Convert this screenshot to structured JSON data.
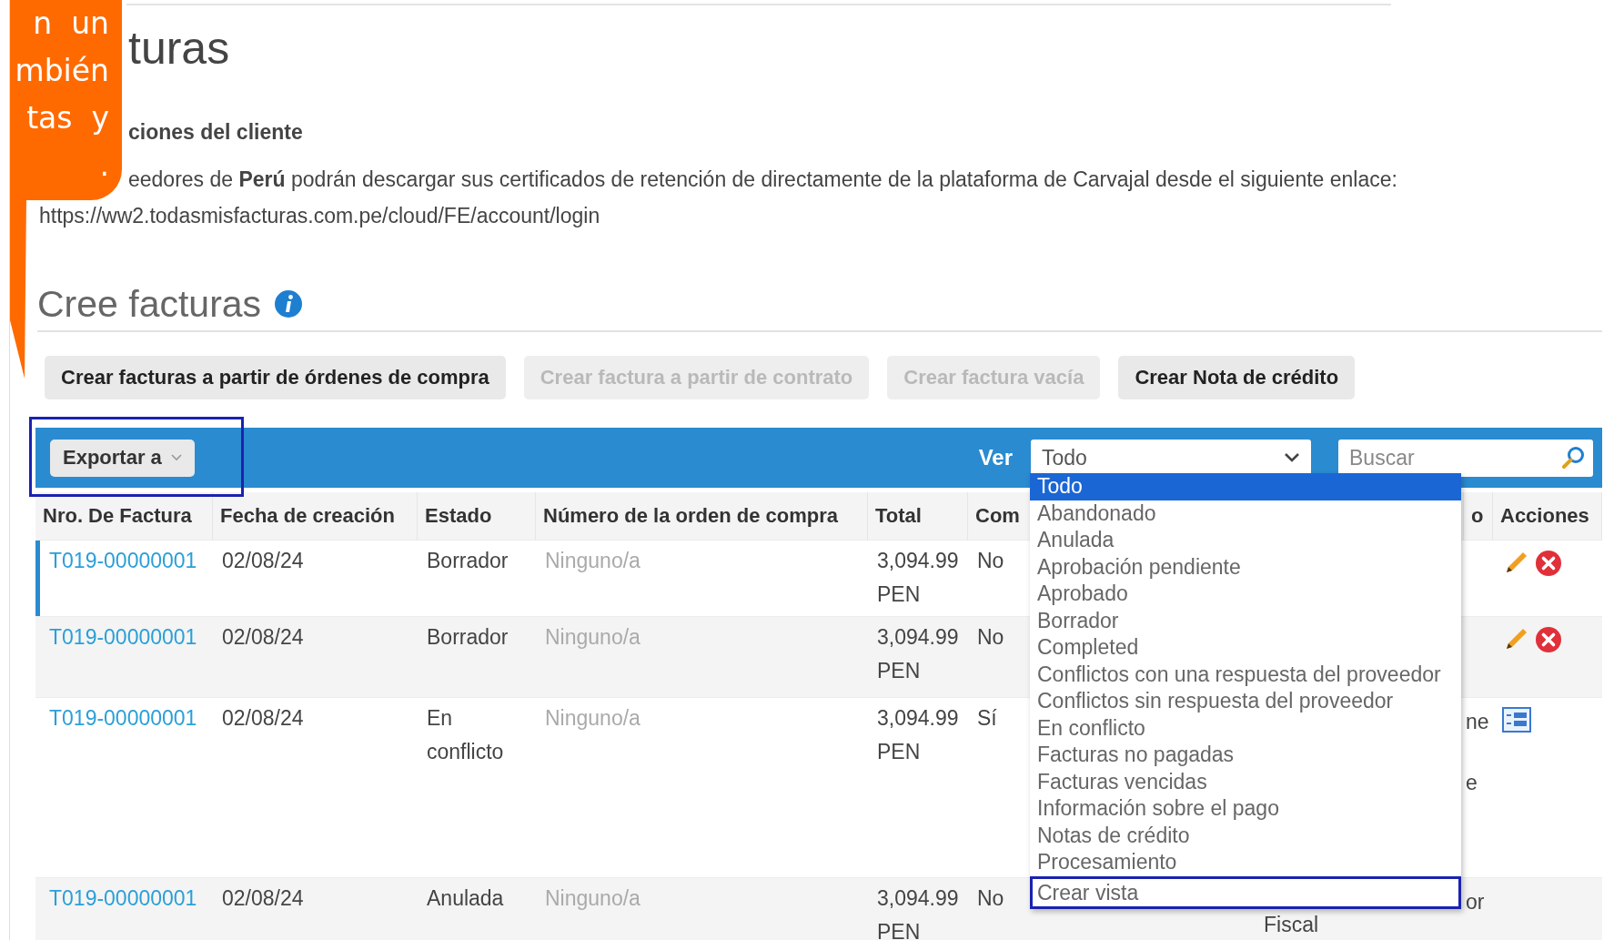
{
  "callout": {
    "lines": [
      "n  un",
      "mbién",
      "tas  y",
      "."
    ]
  },
  "page": {
    "title": "turas",
    "notice": {
      "heading": "ciones del cliente",
      "text": "eedores de **Perú** podrán descargar sus certificados de retención de directamente de la plataforma de Carvajal desde el siguiente enlace:",
      "link": "https://ww2.todasmisfacturas.com.pe/cloud/FE/account/login"
    }
  },
  "section": {
    "title": "Cree facturas"
  },
  "buttons": [
    {
      "label": "Crear facturas a partir de órdenes de compra",
      "disabled": false
    },
    {
      "label": "Crear factura a partir de contrato",
      "disabled": true
    },
    {
      "label": "Crear factura vacía",
      "disabled": true
    },
    {
      "label": "Crear Nota de crédito",
      "disabled": false
    }
  ],
  "toolbar": {
    "export_button": {
      "label": "Exportar a",
      "outlined": true
    },
    "view_label": "Ver",
    "view_select": {
      "value": "Todo",
      "expanded": true,
      "options": [
        {
          "label": "Todo",
          "selected": true,
          "outlined": false
        },
        {
          "label": "Abandonado",
          "selected": false,
          "outlined": false
        },
        {
          "label": "Anulada",
          "selected": false,
          "outlined": false
        },
        {
          "label": "Aprobación pendiente",
          "selected": false,
          "outlined": false
        },
        {
          "label": "Aprobado",
          "selected": false,
          "outlined": false
        },
        {
          "label": "Borrador",
          "selected": false,
          "outlined": false
        },
        {
          "label": "Completed",
          "selected": false,
          "outlined": false
        },
        {
          "label": "Conflictos con una respuesta del proveedor",
          "selected": false,
          "outlined": false
        },
        {
          "label": "Conflictos sin respuesta del proveedor",
          "selected": false,
          "outlined": false
        },
        {
          "label": "En conflicto",
          "selected": false,
          "outlined": false
        },
        {
          "label": "Facturas no pagadas",
          "selected": false,
          "outlined": false
        },
        {
          "label": "Facturas vencidas",
          "selected": false,
          "outlined": false
        },
        {
          "label": "Información sobre el pago",
          "selected": false,
          "outlined": false
        },
        {
          "label": "Notas de crédito",
          "selected": false,
          "outlined": false
        },
        {
          "label": "Procesamiento",
          "selected": false,
          "outlined": false
        },
        {
          "label": "Crear vista",
          "selected": false,
          "outlined": true
        }
      ]
    },
    "search": {
      "placeholder": "Buscar"
    }
  },
  "table": {
    "columns": [
      "Nro. De Factura",
      "Fecha de creación",
      "Estado",
      "Número de la orden de compra",
      "Total",
      "Com",
      "o",
      "Acciones"
    ],
    "rows": [
      {
        "number": "T019-00000001",
        "date": "02/08/24",
        "status": "Borrador",
        "purchase_order": "Ninguno/a",
        "total": "3,094.99 PEN",
        "column_6": "No",
        "actions": [
          {
            "kind": "edit"
          },
          {
            "kind": "delete"
          }
        ],
        "selected": true
      },
      {
        "number": "T019-00000001",
        "date": "02/08/24",
        "status": "Borrador",
        "purchase_order": "Ninguno/a",
        "total": "3,094.99 PEN",
        "column_6": "No",
        "actions": [
          {
            "kind": "edit"
          },
          {
            "kind": "delete"
          }
        ],
        "selected": false
      },
      {
        "number": "T019-00000001",
        "date": "02/08/24",
        "status": "En conflicto",
        "purchase_order": "Ninguno/a",
        "total": "3,094.99 PEN",
        "column_6": "Sí",
        "column_8": [
          "ne",
          "e"
        ],
        "actions": [
          {
            "kind": "details"
          }
        ],
        "selected": false
      },
      {
        "number": "T019-00000001",
        "date": "02/08/24",
        "status": "Anulada",
        "purchase_order": "Ninguno/a",
        "total": "3,094.99 PEN",
        "column_6": "No",
        "column_7": "Fiscal",
        "column_8": [
          "or"
        ],
        "selected": false
      }
    ]
  }
}
